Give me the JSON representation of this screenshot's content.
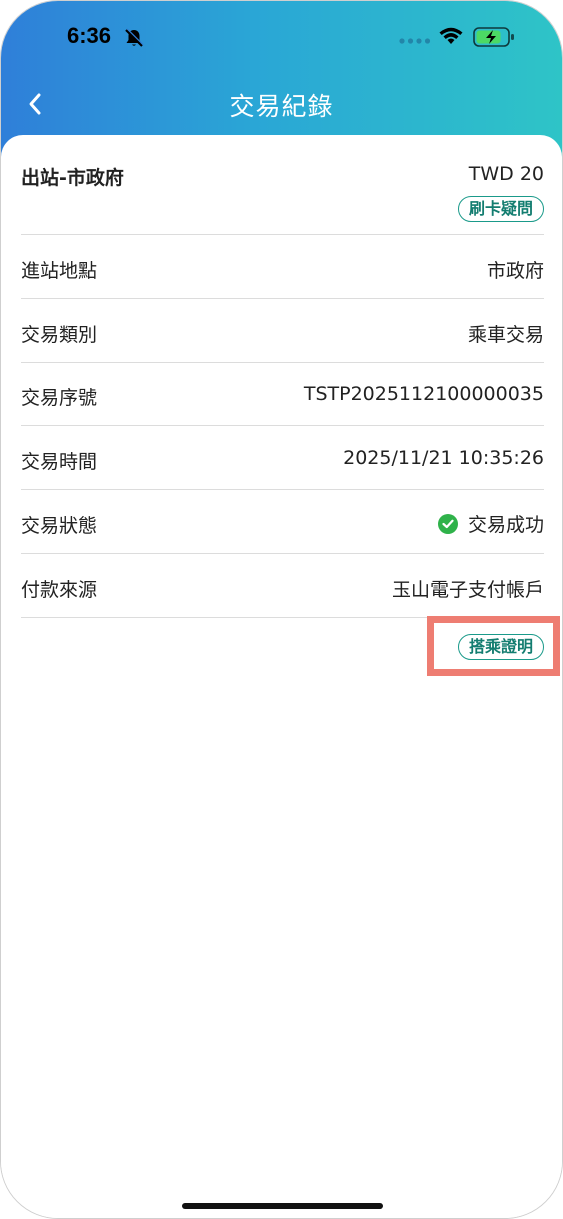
{
  "status_bar": {
    "time": "6:36",
    "bell_icon": "bell-slash-icon",
    "signal_icon": "signal-dots-icon",
    "wifi_icon": "wifi-icon",
    "battery_icon": "battery-charging-icon"
  },
  "nav": {
    "back_icon": "chevron-left-icon",
    "title": "交易紀錄"
  },
  "summary": {
    "station": "出站-市政府",
    "amount": "TWD 20",
    "dispute_button": "刷卡疑問"
  },
  "details": [
    {
      "label": "進站地點",
      "value": "市政府"
    },
    {
      "label": "交易類別",
      "value": "乘車交易"
    },
    {
      "label": "交易序號",
      "value": "TSTP2025112100000035"
    },
    {
      "label": "交易時間",
      "value": "2025/11/21 10:35:26"
    },
    {
      "label": "交易狀態",
      "value": "交易成功",
      "icon": "check-circle-icon"
    },
    {
      "label": "付款來源",
      "value": "玉山電子支付帳戶"
    }
  ],
  "ride_proof_button": "搭乘證明",
  "colors": {
    "header_gradient_start": "#2f7fd9",
    "header_gradient_end": "#2ec4c7",
    "pill_accent": "#1a9a8a",
    "success": "#2fb24a",
    "highlight": "#ee7d72"
  }
}
